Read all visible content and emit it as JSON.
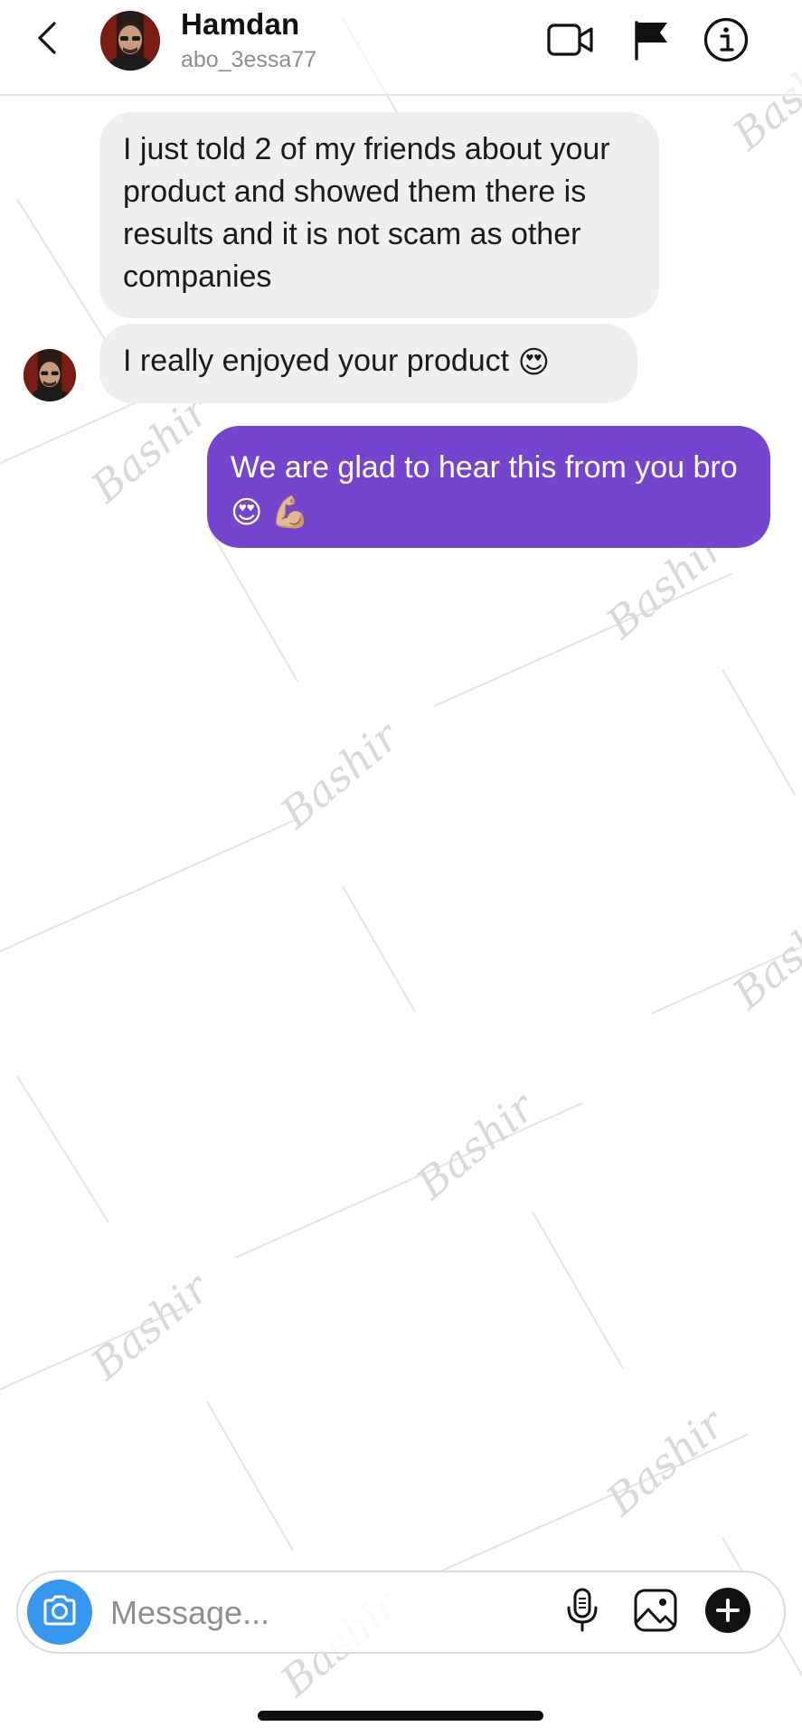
{
  "header": {
    "name": "Hamdan",
    "username": "abo_3essa77",
    "icons": [
      "chevron-left-icon",
      "video-camera-icon",
      "flag-icon",
      "info-icon"
    ]
  },
  "messages": [
    {
      "direction": "incoming",
      "text": "I just told 2 of my friends about your product and showed them there is results and it is not scam as other companies"
    },
    {
      "direction": "incoming",
      "text": "I really enjoyed your product",
      "emoji": "😍"
    },
    {
      "direction": "outgoing",
      "text": "We are glad to hear this from you bro",
      "emoji": "😍 💪🏼"
    }
  ],
  "composer": {
    "placeholder": "Message...",
    "icons": [
      "camera-icon",
      "microphone-icon",
      "image-icon",
      "plus-icon"
    ]
  },
  "colors": {
    "outgoing_bubble": "#7645cf",
    "incoming_bubble": "#efefef",
    "camera_button": "#3797f0",
    "secondary_text": "#8e8e8e"
  }
}
